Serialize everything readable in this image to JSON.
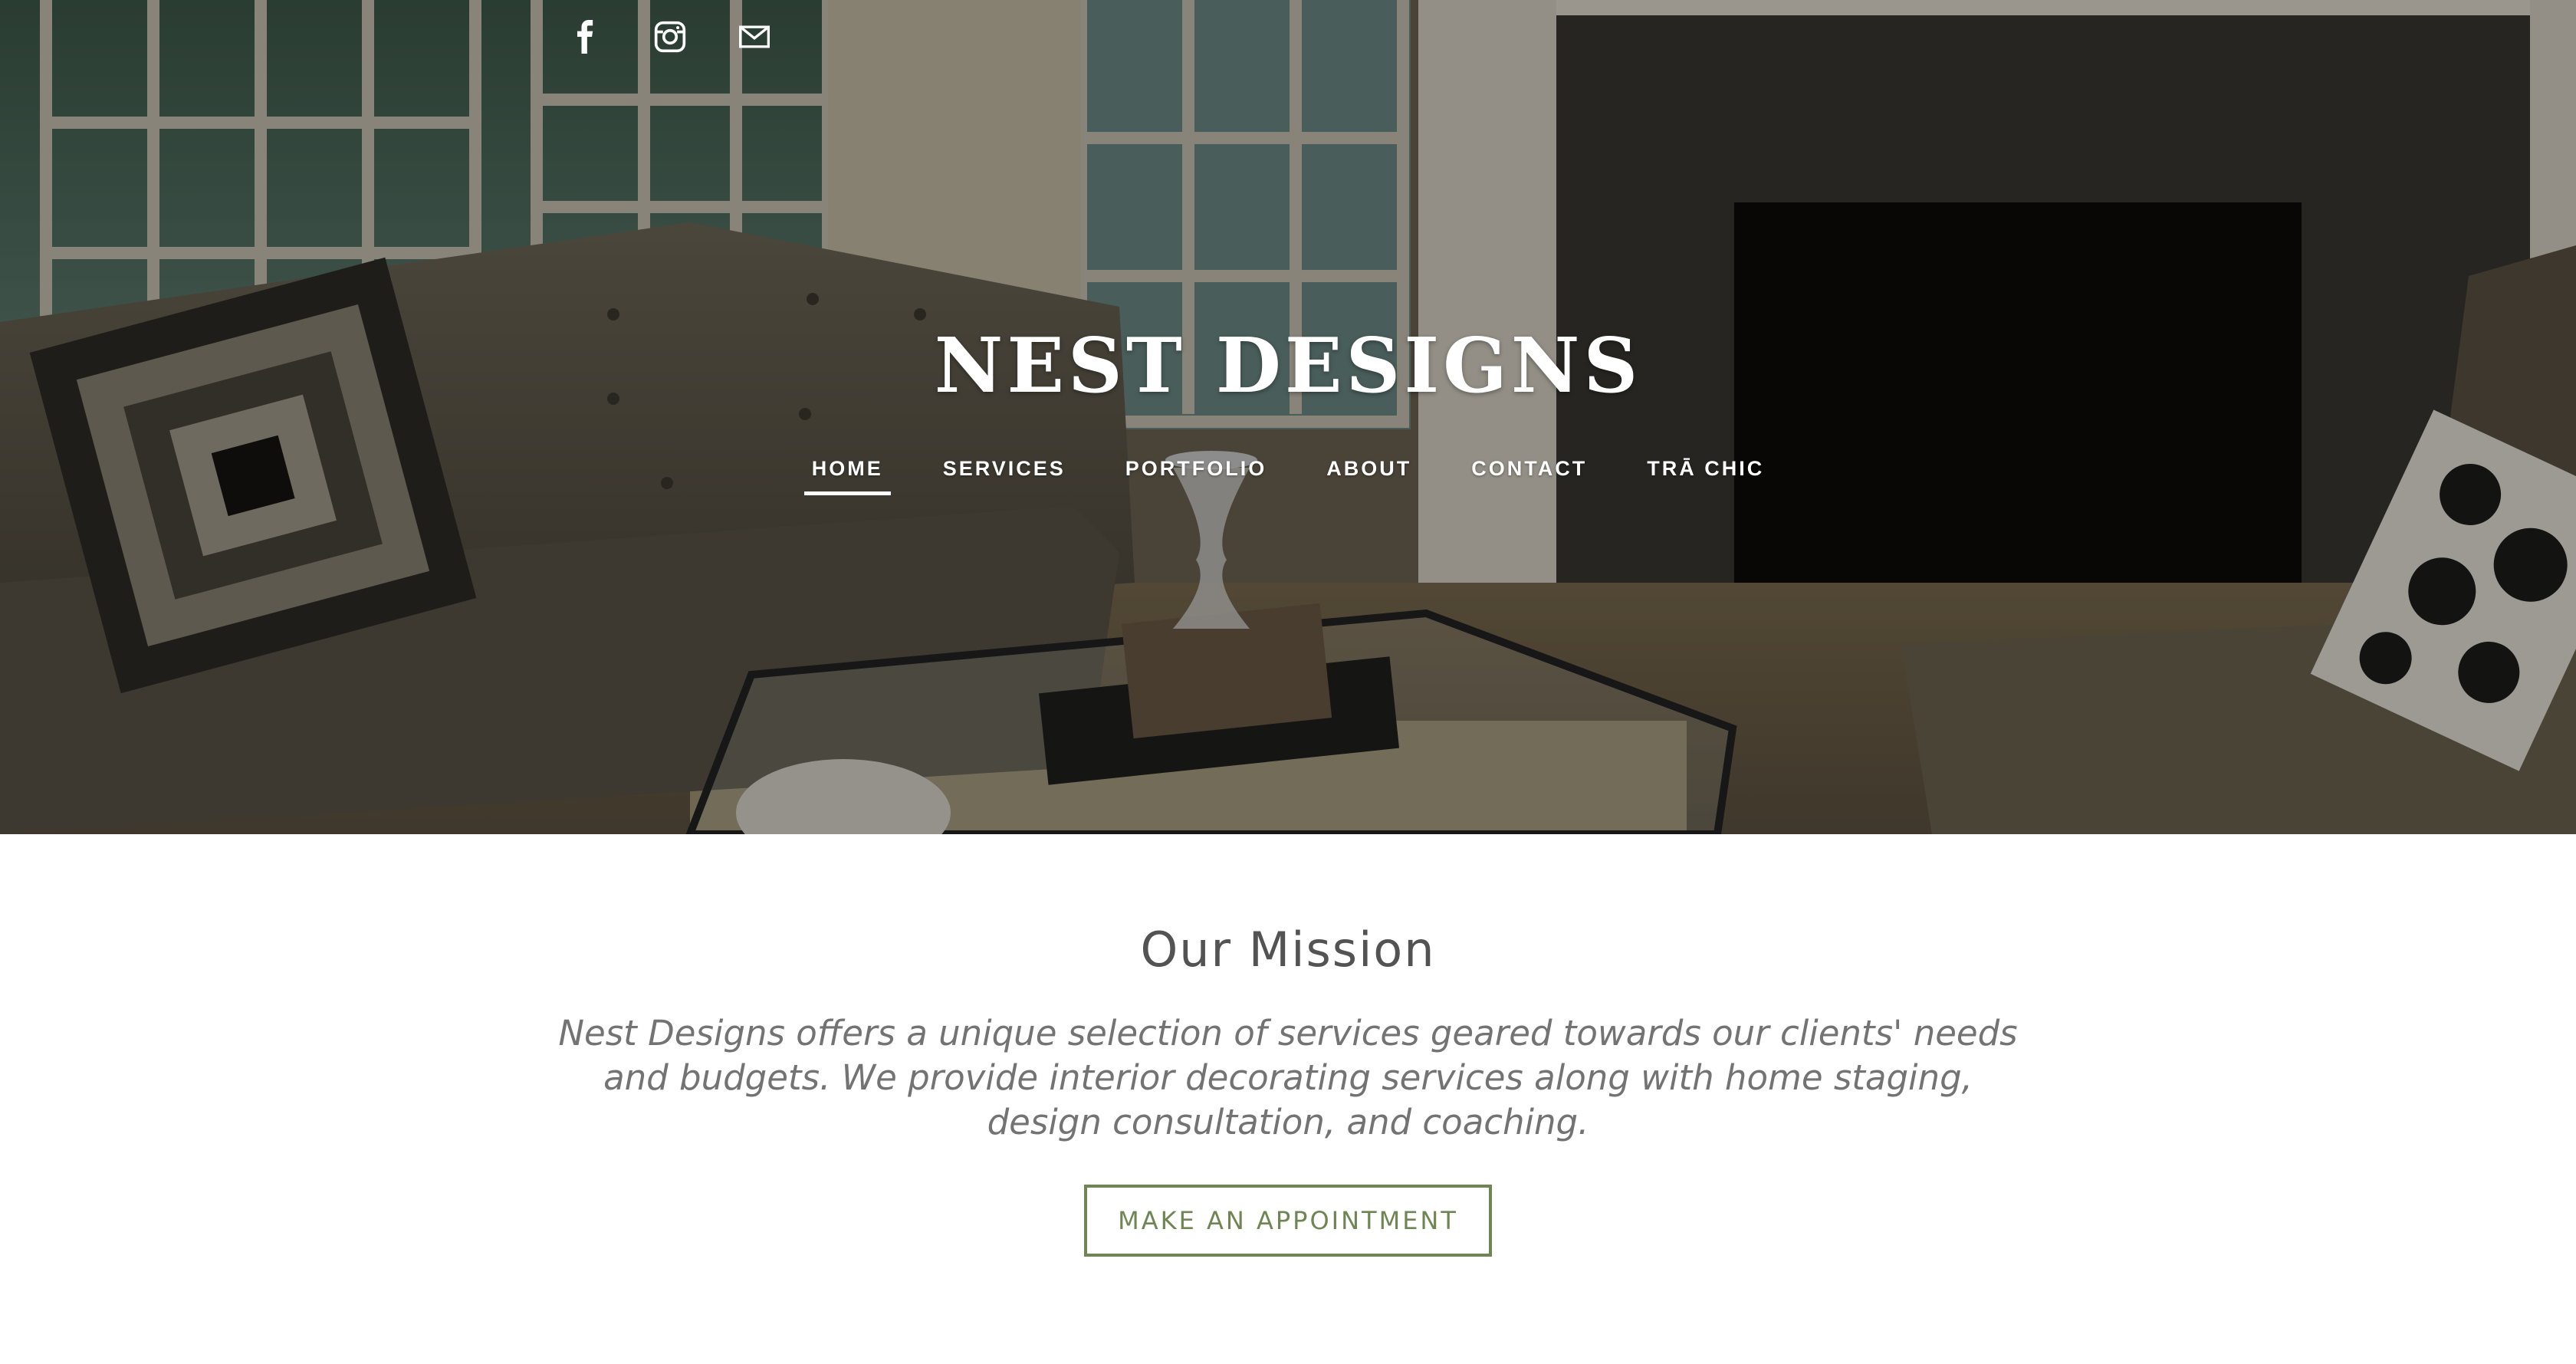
{
  "site": {
    "brand": "NEST DESIGNS"
  },
  "social": [
    {
      "name": "facebook-icon"
    },
    {
      "name": "instagram-icon"
    },
    {
      "name": "mail-icon"
    }
  ],
  "nav": {
    "items": [
      {
        "label": "HOME",
        "active": true
      },
      {
        "label": "SERVICES"
      },
      {
        "label": "PORTFOLIO"
      },
      {
        "label": "ABOUT"
      },
      {
        "label": "CONTACT"
      },
      {
        "label": "TRĀ CHIC"
      }
    ]
  },
  "mission": {
    "title": "Our Mission",
    "text": "Nest Designs offers a unique selection of services geared towards our clients' needs and budgets. We provide interior decorating services along with home staging, design consultation, and coaching.",
    "cta_label": "MAKE AN APPOINTMENT"
  },
  "colors": {
    "accent": "#6f8654",
    "heading": "#535353",
    "body_text": "#737373"
  }
}
